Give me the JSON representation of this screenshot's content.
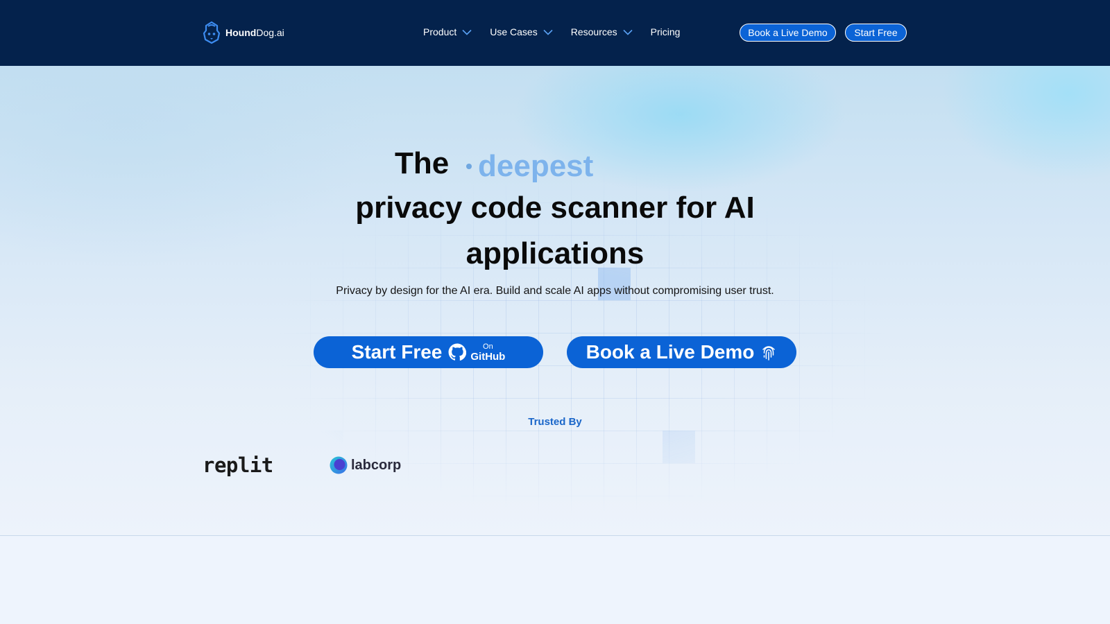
{
  "brand": {
    "name_bold": "Hound",
    "name_rest": "Dog.ai",
    "logo_icon": "hound-shield-icon"
  },
  "nav": {
    "items": [
      {
        "label": "Product",
        "has_dropdown": true
      },
      {
        "label": "Use Cases",
        "has_dropdown": true
      },
      {
        "label": "Resources",
        "has_dropdown": true
      },
      {
        "label": "Pricing",
        "has_dropdown": false
      }
    ],
    "demo_button": "Book a Live Demo",
    "start_button": "Start Free"
  },
  "hero": {
    "title_prefix": "The",
    "title_rotating_word": "deepest",
    "title_line2": "privacy code scanner for AI",
    "title_line3": "applications",
    "subtitle": "Privacy by design for the AI era. Build and scale AI apps without compromising user trust.",
    "cta_start": {
      "label": "Start Free",
      "on": "On",
      "platform": "GitHub",
      "icon": "github-icon"
    },
    "cta_demo": {
      "label": "Book a Live Demo",
      "icon": "fingerprint-icon"
    }
  },
  "trusted": {
    "label": "Trusted By",
    "logos": [
      "replit",
      "labcorp"
    ]
  },
  "colors": {
    "nav_bg": "#04224c",
    "accent": "#0b63d6",
    "rotating_word": "#7db3ec",
    "trusted_label": "#1a66c9"
  }
}
